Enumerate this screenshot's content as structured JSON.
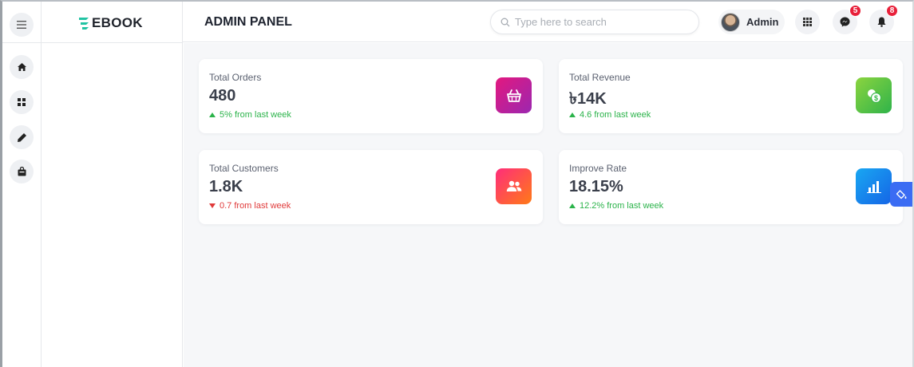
{
  "app": {
    "brand": "EBOOK",
    "page_title": "ADMIN PANEL"
  },
  "search": {
    "placeholder": "Type here to search"
  },
  "user": {
    "name": "Admin"
  },
  "notifications": {
    "messages_count": "5",
    "alerts_count": "8"
  },
  "rail": {
    "items": [
      {
        "icon": "home-icon"
      },
      {
        "icon": "grid-icon"
      },
      {
        "icon": "pencil-icon"
      },
      {
        "icon": "shopping-bag-icon"
      }
    ]
  },
  "stats": [
    {
      "label": "Total Orders",
      "value": "480",
      "trend": "5% from last week",
      "direction": "up",
      "icon": "basket-icon",
      "gradient": [
        "#e3187f",
        "#9b27b0"
      ]
    },
    {
      "label": "Total Revenue",
      "value": "৳14K",
      "trend": "4.6 from last week",
      "direction": "up",
      "icon": "coins-icon",
      "gradient": [
        "#8bd43f",
        "#2fb34a"
      ]
    },
    {
      "label": "Total Customers",
      "value": "1.8K",
      "trend": "0.7 from last week",
      "direction": "down",
      "icon": "users-icon",
      "gradient": [
        "#ff2d7a",
        "#ff7a17"
      ]
    },
    {
      "label": "Improve Rate",
      "value": "18.15%",
      "trend": "12.2% from last week",
      "direction": "up",
      "icon": "bar-chart-icon",
      "gradient": [
        "#19a7f2",
        "#1565e6"
      ]
    }
  ],
  "colors": {
    "accent_teal": "#21c3a3",
    "badge_red": "#e8203a",
    "up_green": "#2bb34a",
    "down_red": "#e03a3a",
    "float_blue": "#3b6cf3"
  }
}
